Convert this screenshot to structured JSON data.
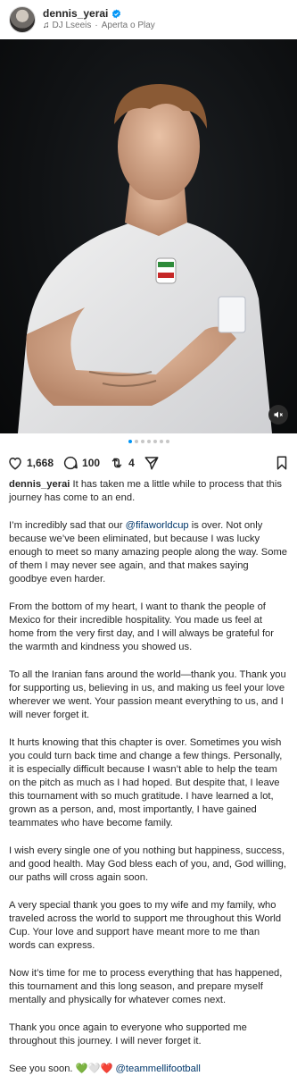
{
  "header": {
    "username": "dennis_yerai",
    "audio_track": "DJ Lseeis",
    "audio_action": "Aperta o Play"
  },
  "carousel": {
    "total": 7,
    "active": 0
  },
  "actions": {
    "likes": "1,668",
    "comments": "100",
    "reposts": "4"
  },
  "caption": {
    "username": "dennis_yerai",
    "intro": "It has taken me a little while to process that this journey has come to an end.",
    "p2_before": "I’m incredibly sad that our ",
    "p2_mention": "@fifaworldcup",
    "p2_after": " is over. Not only because we’ve been eliminated, but because I was lucky enough to meet so many amazing people along the way. Some of them I may never see again, and that makes saying goodbye even harder.",
    "p3": "From the bottom of my heart, I want to thank the people of Mexico for their incredible hospitality. You made us feel at home from the very first day, and I will always be grateful for the warmth and kindness you showed us.",
    "p4": "To all the Iranian fans around the world—thank you. Thank you for supporting us, believing in us, and making us feel your love wherever we went. Your passion meant everything to us, and I will never forget it.",
    "p5": "It hurts knowing that this chapter is over. Sometimes you wish you could turn back time and change a few things. Personally, it is especially difficult because I wasn’t able to help the team on the pitch as much as I had hoped. But despite that, I leave this tournament with so much gratitude. I have learned a lot, grown as a person, and, most importantly, I have gained teammates who have become family.",
    "p6": "I wish every single one of you nothing but happiness, success, and good health. May God bless each of you, and, God willing, our paths will cross again soon.",
    "p7": "A very special thank you goes to my wife and my family, who traveled across the world to support me throughout this World Cup. Your love and support have meant more to me than words can express.",
    "p8": "Now it’s time for me to process everything that has happened, this tournament and this long season, and prepare myself mentally and physically for whatever comes next.",
    "p9": "Thank you once again to everyone who supported me throughout this journey. I will never forget it.",
    "p10_text": "See you soon. ",
    "p10_emoji": "💚🤍❤️",
    "p10_mention": "@teammellifootball"
  },
  "colors": {
    "link": "#00376b",
    "verified": "#0095f6",
    "active_dot": "#0095f6"
  }
}
